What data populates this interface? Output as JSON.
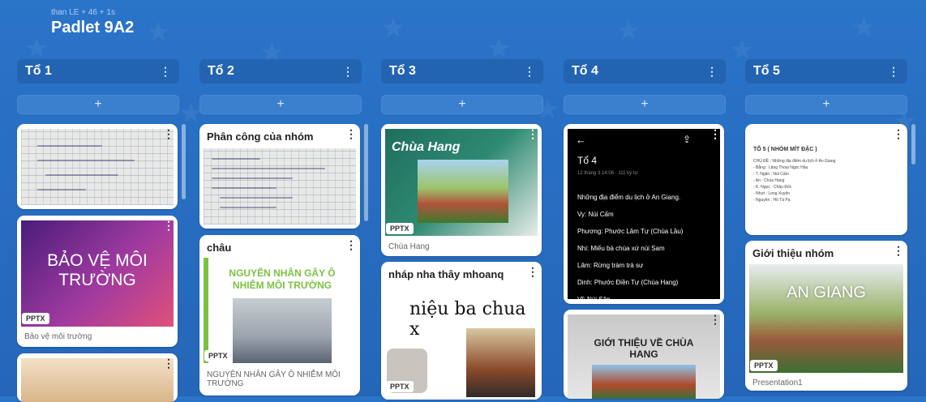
{
  "board": {
    "meta": "than LE + 46 + 1s",
    "title": "Padlet 9A2"
  },
  "columns": [
    {
      "title": "Tổ 1"
    },
    {
      "title": "Tổ 2"
    },
    {
      "title": "Tổ 3"
    },
    {
      "title": "Tổ 4"
    },
    {
      "title": "Tổ 5"
    }
  ],
  "ui": {
    "add": "+",
    "dots": "⋮"
  },
  "cards": {
    "c1b": {
      "slide_text": "BẢO VỆ MÔI TRƯỜNG",
      "badge": "PPTX",
      "caption": "Bảo vệ môi trường"
    },
    "c2a": {
      "title": "Phân công của nhóm"
    },
    "c2b": {
      "title": "châu",
      "slide_text": "NGUYÊN NHÂN GÂY Ô NHIỄM MÔI TRƯỜNG",
      "badge": "PPTX",
      "caption": "NGUYÊN NHÂN GÂY Ô NHIỄM MÔI TRƯỜNG"
    },
    "c3a": {
      "slide_text": "Chùa Hang",
      "badge": "PPTX",
      "caption": "Chùa Hang"
    },
    "c3b": {
      "title": "nháp nha thây mhoanq",
      "slide_text": "niệu ba chua x",
      "badge": "PPTX"
    },
    "c4a": {
      "heading": "Tổ 4",
      "sub": "12 tháng 3 14:06 · 111 ký tự",
      "lines": [
        "Những địa điểm du lịch ở An Giang.",
        "Vy: Núi Cấm",
        "Phương: Phước Lâm Tự (Chùa Lầu)",
        "Nhi: Miếu bà chúa xứ núi Sam",
        "Lâm: Rừng tràm trà sư",
        "Dinh: Phước Điền Tự (Chùa Hang)",
        "Vĩ: Núi Sập"
      ]
    },
    "c4b": {
      "slide_text": "GIỚI THIỆU VỀ CHÙA HANG"
    },
    "c5a": {
      "heading": "TỔ 5 ( NHÓM MÍT ĐẶC )",
      "lines": [
        "CHỦ ĐỀ : Những địa điểm du lịch ở An Giang",
        "- Bằng : Lăng Thoại Ngọc Hầu",
        "- T. Ngân : Núi Cấm",
        "- An : Chùa Hang",
        "- K. Ngọc : Châu Đốc",
        "- Nhựt : Long Xuyên",
        "- Nguyên : Hồ Tà Pạ"
      ]
    },
    "c5b": {
      "title": "Giới thiệu nhóm",
      "slide_text": "AN GIANG",
      "badge": "PPTX",
      "caption": "Presentation1"
    }
  },
  "colors": {
    "background": "#2a74c9",
    "card": "#ffffff"
  }
}
